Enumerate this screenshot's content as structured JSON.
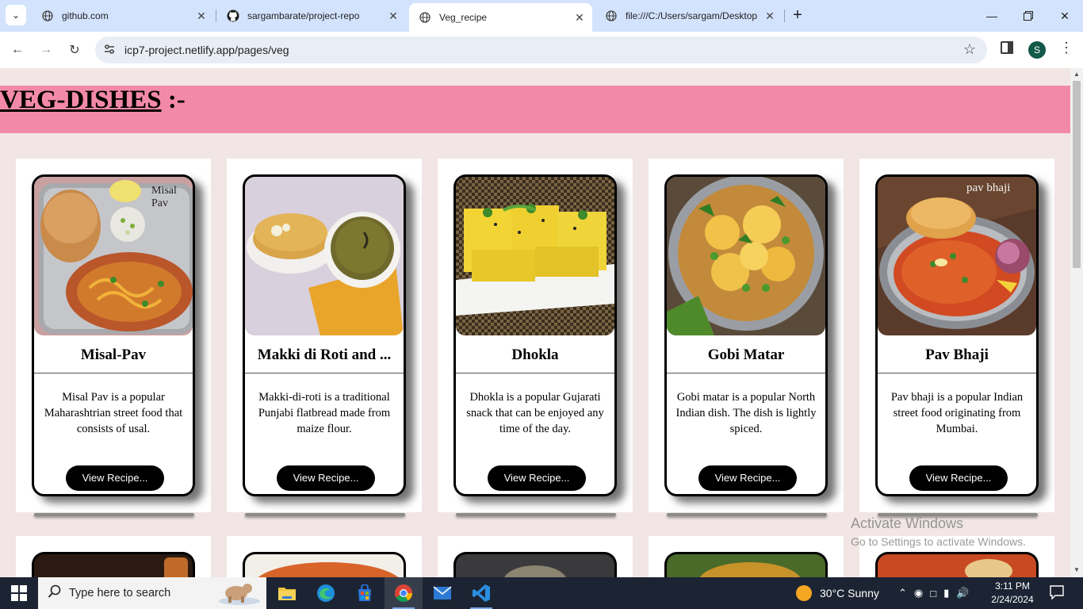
{
  "browser": {
    "tabs": [
      {
        "title": "github.com",
        "icon": "globe-icon",
        "active": false
      },
      {
        "title": "sargambarate/project-repo",
        "icon": "github-icon",
        "active": false
      },
      {
        "title": "Veg_recipe",
        "icon": "globe-icon",
        "active": true
      },
      {
        "title": "file:///C:/Users/sargam/Desktop",
        "icon": "globe-icon",
        "active": false
      }
    ],
    "url": "icp7-project.netlify.app/pages/veg",
    "profile_initial": "S"
  },
  "page": {
    "heading": "VEG-DISHES",
    "heading_suffix": " :-",
    "header_color": "#f389a8",
    "background_color": "#f1e6e5",
    "cards": [
      {
        "name": "Misal-Pav",
        "description": "Misal Pav is a popular Maharashtrian street food that consists of usal.",
        "button": "View Recipe...",
        "image_label": "Misal Pav"
      },
      {
        "name": "Makki di Roti and ...",
        "description": "Makki-di-roti is a traditional Punjabi flatbread made from maize flour.",
        "button": "View Recipe...",
        "image_label": ""
      },
      {
        "name": "Dhokla",
        "description": "Dhokla is a popular Gujarati snack that can be enjoyed any time of the day.",
        "button": "View Recipe...",
        "image_label": ""
      },
      {
        "name": "Gobi Matar",
        "description": "Gobi matar is a popular North Indian dish. The dish is lightly spiced.",
        "button": "View Recipe...",
        "image_label": ""
      },
      {
        "name": "Pav Bhaji",
        "description": "Pav bhaji is a popular Indian street food originating from Mumbai.",
        "button": "View Recipe...",
        "image_label": "pav bhaji"
      }
    ]
  },
  "watermark": {
    "line1": "Activate Windows",
    "line2": "Go to Settings to activate Windows."
  },
  "taskbar": {
    "search_placeholder": "Type here to search",
    "weather": "30°C  Sunny",
    "time": "3:11 PM",
    "date": "2/24/2024"
  }
}
